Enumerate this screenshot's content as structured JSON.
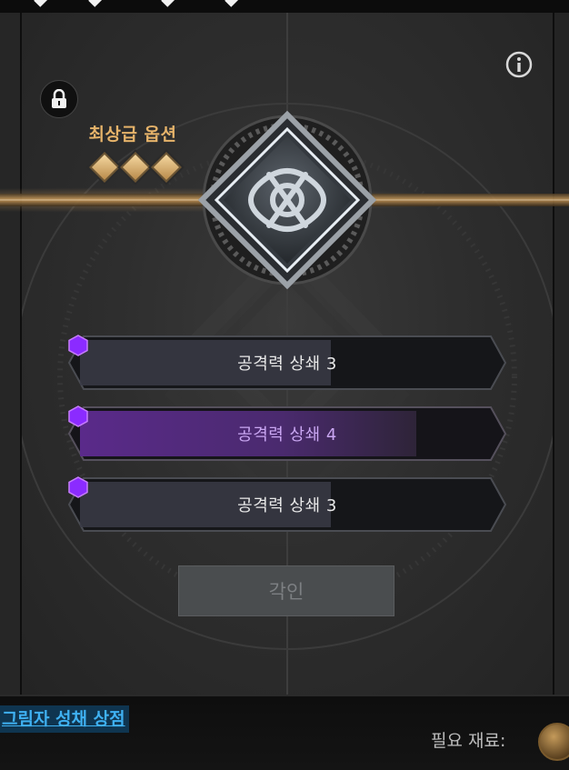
{
  "panel": {
    "grade_label": "최상급 옵션",
    "grade_level": 3,
    "options": [
      {
        "label": "공격력 상쇄 3",
        "tier": "purple",
        "progress": 0.6,
        "selected": false
      },
      {
        "label": "공격력 상쇄 4",
        "tier": "purple",
        "progress": 0.8,
        "selected": true
      },
      {
        "label": "공격력 상쇄 3",
        "tier": "purple",
        "progress": 0.6,
        "selected": false
      }
    ],
    "engrave_button": "각인"
  },
  "footer": {
    "shop_link": "그림자 성채 상점",
    "required_materials_label": "필요 재료:"
  },
  "icons": {
    "lock": "lock-icon",
    "info": "info-icon",
    "emblem": "celtic-knot-icon",
    "gem": "diamond-gem-icon",
    "option": "hexagon-gem-icon",
    "coin": "coin-icon"
  },
  "colors": {
    "accent_gold": "#e6b36a",
    "purple": "#8b2bff",
    "link_blue": "#3fb1f2",
    "selected_text": "#c9a6f2"
  }
}
